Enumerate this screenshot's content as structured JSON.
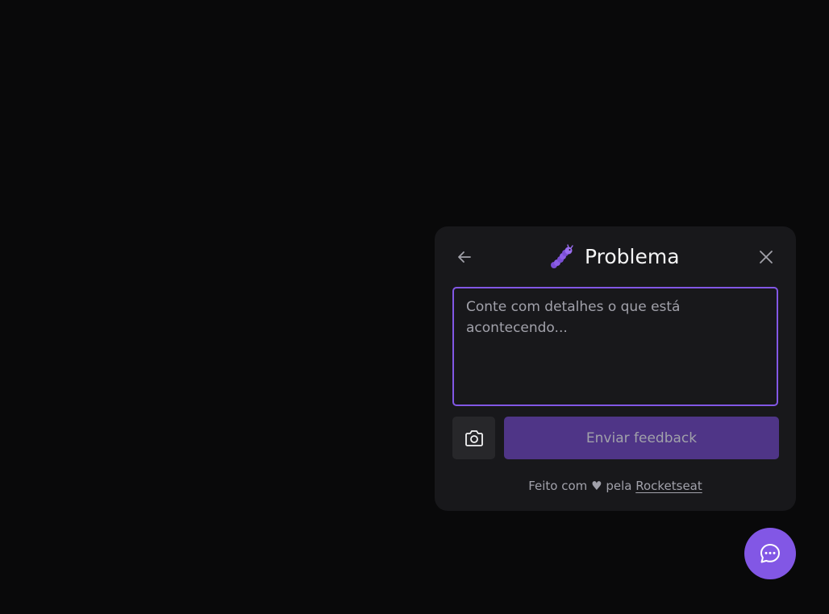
{
  "widget": {
    "title": "Problema",
    "title_icon": "bug-emoji-icon",
    "back_icon": "arrow-left-icon",
    "close_icon": "close-icon",
    "textarea": {
      "value": "",
      "placeholder": "Conte com detalhes o que está acontecendo..."
    },
    "screenshot_icon": "camera-icon",
    "submit_label": "Enviar feedback",
    "footer": {
      "prefix": "Feito com",
      "heart": "♥",
      "middle": "pela",
      "link_label": "Rocketseat"
    }
  },
  "fab": {
    "icon": "chat-dots-icon"
  },
  "colors": {
    "background": "#09090a",
    "panel": "#18181b",
    "brand": "#8257e5",
    "brand_disabled": "#4f3587",
    "text_primary": "#f4f4f5",
    "text_secondary": "#a1a1aa",
    "surface_secondary": "#27272a"
  }
}
